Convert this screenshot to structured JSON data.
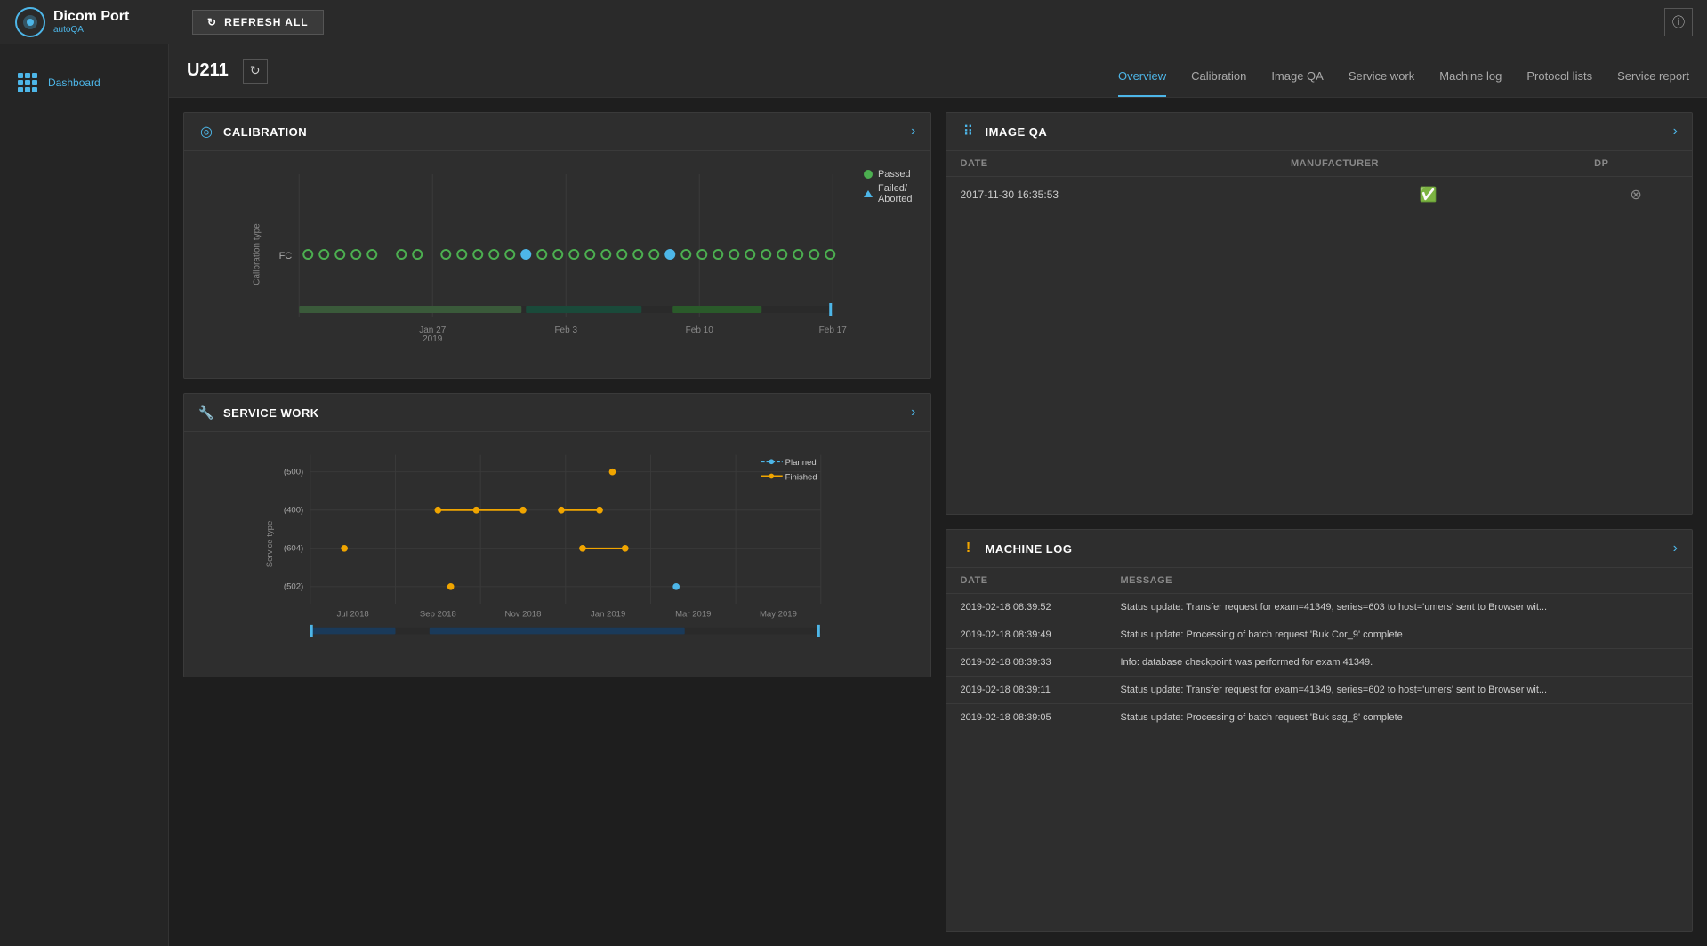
{
  "app": {
    "logo_main": "Dicom Port",
    "logo_sub": "autoQA",
    "refresh_label": "REFRESH ALL",
    "info_label": "ⓘ"
  },
  "sidebar": {
    "items": [
      {
        "label": "Dashboard",
        "active": true
      }
    ]
  },
  "device": {
    "id": "U211",
    "nav_items": [
      {
        "label": "Overview",
        "active": true
      },
      {
        "label": "Calibration",
        "active": false
      },
      {
        "label": "Image QA",
        "active": false
      },
      {
        "label": "Service work",
        "active": false
      },
      {
        "label": "Machine log",
        "active": false
      },
      {
        "label": "Protocol lists",
        "active": false
      },
      {
        "label": "Service report",
        "active": false
      }
    ]
  },
  "calibration": {
    "title": "CALIBRATION",
    "legend": {
      "passed": "Passed",
      "failed": "Failed/",
      "aborted": "Aborted"
    },
    "axis_label": "Calibration type",
    "row_label": "FC",
    "dates": [
      "Jan 27\n2019",
      "Feb 3",
      "Feb 10",
      "Feb 17"
    ]
  },
  "image_qa": {
    "title": "IMAGE QA",
    "columns": [
      "DATE",
      "MANUFACTURER",
      "DP"
    ],
    "rows": [
      {
        "date": "2017-11-30  16:35:53",
        "manufacturer_status": "check",
        "dp_status": "x"
      }
    ]
  },
  "service_work": {
    "title": "SERVICE WORK",
    "legend": {
      "planned": "Planned",
      "finished": "Finished"
    },
    "axis_label": "Service type",
    "y_labels": [
      "(500)",
      "(400)",
      "(604)",
      "(502)"
    ],
    "x_labels": [
      "Jul 2018",
      "Sep 2018",
      "Nov 2018",
      "Jan 2019",
      "Mar 2019",
      "May 2019"
    ]
  },
  "machine_log": {
    "title": "MACHINE LOG",
    "columns": [
      "DATE",
      "MESSAGE"
    ],
    "rows": [
      {
        "date": "2019-02-18  08:39:52",
        "message": "Status update: Transfer request for exam=41349, series=603 to host='umers' sent to Browser wit..."
      },
      {
        "date": "2019-02-18  08:39:49",
        "message": "Status update: Processing of batch request 'Buk Cor_9' complete"
      },
      {
        "date": "2019-02-18  08:39:33",
        "message": "Info: database checkpoint was performed for exam 41349."
      },
      {
        "date": "2019-02-18  08:39:11",
        "message": "Status update: Transfer request for exam=41349, series=602 to host='umers' sent to Browser wit..."
      },
      {
        "date": "2019-02-18  08:39:05",
        "message": "Status update: Processing of batch request 'Buk sag_8' complete"
      }
    ]
  }
}
